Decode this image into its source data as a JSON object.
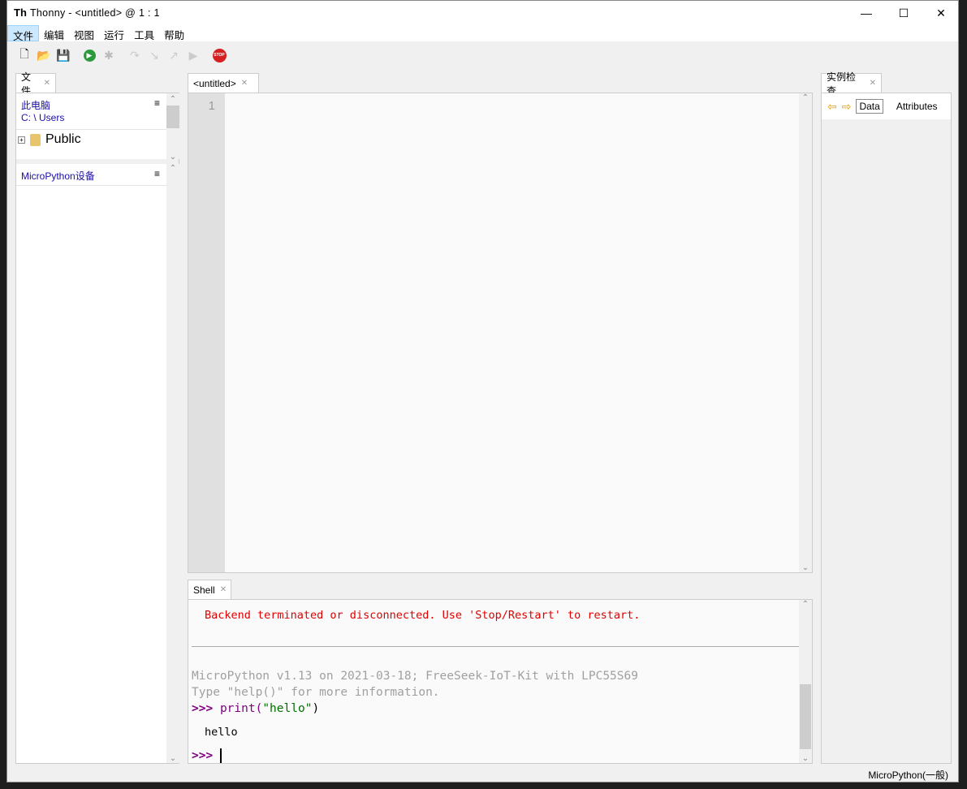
{
  "window": {
    "title": "Thonny  -  <untitled>  @  1 : 1",
    "logo": "Th",
    "minimize": "—",
    "maximize": "☐",
    "close": "✕"
  },
  "menu": [
    {
      "label": "文件",
      "active": true
    },
    {
      "label": "编辑"
    },
    {
      "label": "视图"
    },
    {
      "label": "运行"
    },
    {
      "label": "工具"
    },
    {
      "label": "帮助"
    }
  ],
  "toolbar": [
    "new-file",
    "open-file",
    "save",
    "run",
    "debug",
    "step-over",
    "step-into",
    "step-out",
    "resume",
    "stop"
  ],
  "files": {
    "tab": "文件",
    "section1_title": "此电脑",
    "path": "C: \\ Users",
    "items": [
      {
        "name": "Public",
        "type": "folder"
      }
    ],
    "section2_title": "MicroPython设备",
    "menu_glyph": "≡"
  },
  "editor": {
    "tab": "<untitled>",
    "line_numbers": [
      "1"
    ]
  },
  "shell": {
    "tab": "Shell",
    "error": "Backend terminated or disconnected. Use 'Stop/Restart' to restart.",
    "banner1": "MicroPython v1.13 on 2021-03-18; FreeSeek-IoT-Kit with LPC55S69",
    "banner2": "Type \"help()\" for more information.",
    "prompt": ">>>",
    "command_fn": "print(",
    "command_str": "\"hello\"",
    "command_end": ")",
    "output": "hello"
  },
  "inspector": {
    "tab": "实例检查",
    "data_tab": "Data",
    "attributes_tab": "Attributes"
  },
  "status": {
    "interpreter": "MicroPython(一般)"
  },
  "colors": {
    "error": "#e00000",
    "prompt": "#800080",
    "string": "#007000",
    "banner": "#a0a0a0",
    "link": "#1a0dab"
  }
}
